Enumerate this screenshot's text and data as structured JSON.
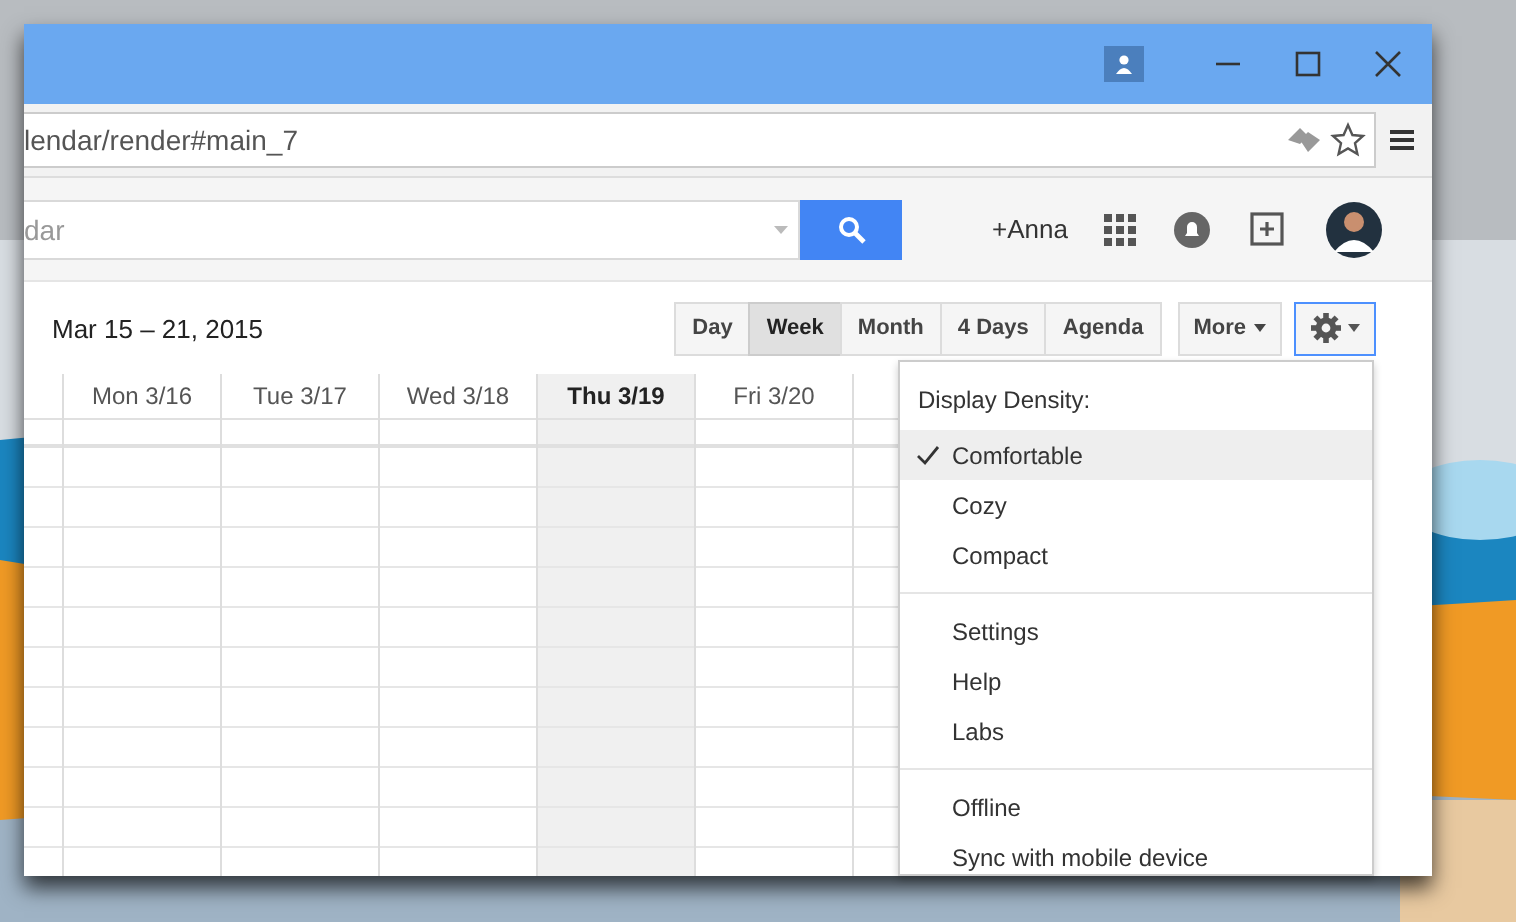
{
  "address_bar": {
    "url": "lendar/render#main_7"
  },
  "search": {
    "placeholder": "dar"
  },
  "account": {
    "name": "+Anna"
  },
  "toolbar": {
    "date_range": "Mar 15 – 21, 2015",
    "views": [
      {
        "label": "Day",
        "selected": false
      },
      {
        "label": "Week",
        "selected": true
      },
      {
        "label": "Month",
        "selected": false
      },
      {
        "label": "4 Days",
        "selected": false
      },
      {
        "label": "Agenda",
        "selected": false
      }
    ],
    "more": "More"
  },
  "days": [
    {
      "label": "Mon 3/16",
      "selected": false
    },
    {
      "label": "Tue 3/17",
      "selected": false
    },
    {
      "label": "Wed 3/18",
      "selected": false
    },
    {
      "label": "Thu 3/19",
      "selected": true
    },
    {
      "label": "Fri 3/20",
      "selected": false
    }
  ],
  "settings_menu": {
    "header": "Display Density:",
    "sections": [
      [
        {
          "label": "Comfortable",
          "checked": true,
          "highlighted": true
        },
        {
          "label": "Cozy",
          "checked": false,
          "highlighted": false
        },
        {
          "label": "Compact",
          "checked": false,
          "highlighted": false
        }
      ],
      [
        {
          "label": "Settings",
          "checked": false,
          "highlighted": false
        },
        {
          "label": "Help",
          "checked": false,
          "highlighted": false
        },
        {
          "label": "Labs",
          "checked": false,
          "highlighted": false
        }
      ],
      [
        {
          "label": "Offline",
          "checked": false,
          "highlighted": false
        },
        {
          "label": "Sync with mobile device",
          "checked": false,
          "highlighted": false
        }
      ]
    ]
  }
}
